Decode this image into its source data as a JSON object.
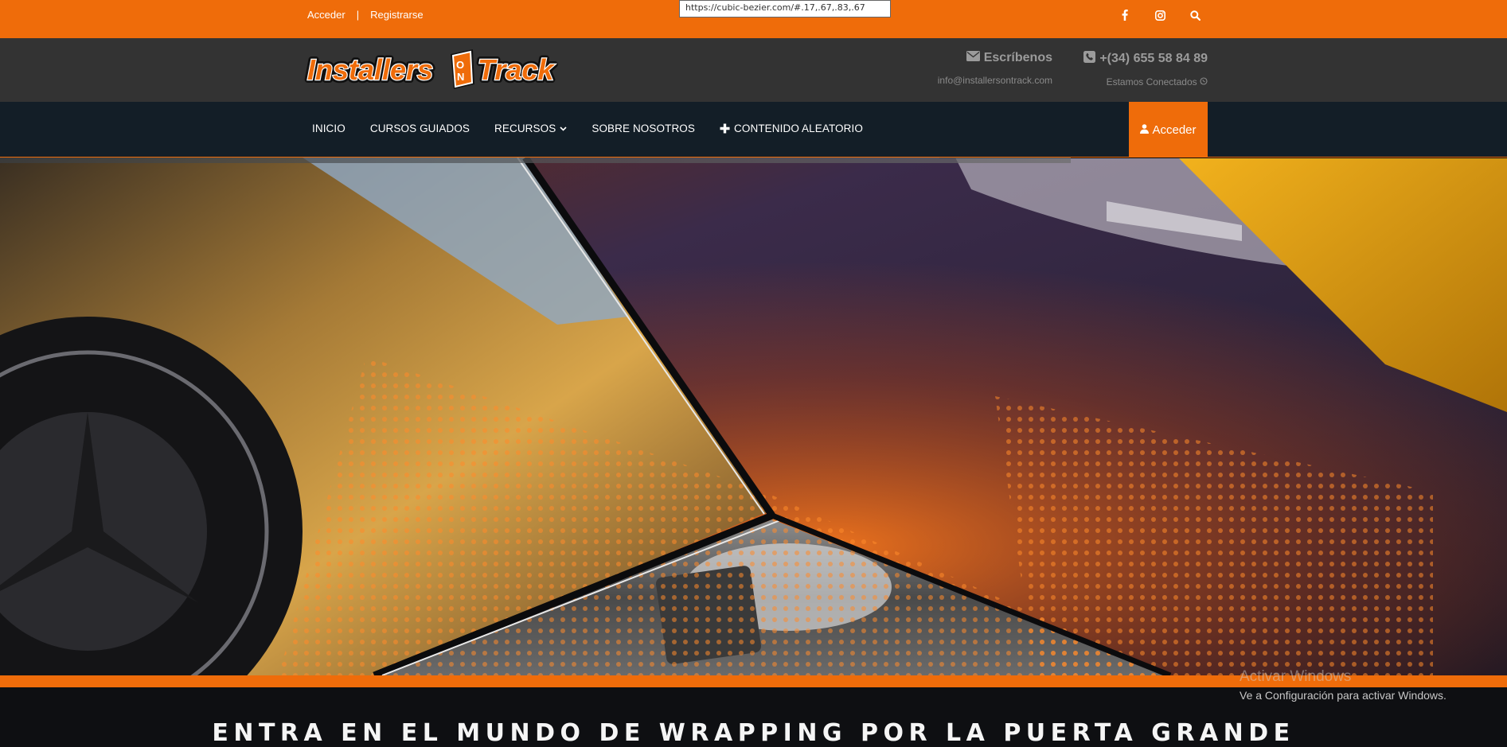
{
  "topbar": {
    "login_label": "Acceder",
    "separator": "|",
    "register_label": "Registrarse",
    "social_icons": [
      "facebook-icon",
      "instagram-icon",
      "search-icon"
    ]
  },
  "url_tooltip": "https://cubic-bezier.com/#.17,.67,.83,.67",
  "header": {
    "logo_text": "Installers ON Track",
    "email": {
      "title": "Escríbenos",
      "address": "info@installersontrack.com"
    },
    "phone": {
      "number": "+(34) 655 58 84 89",
      "status": "Estamos Conectados"
    }
  },
  "nav": {
    "items": [
      {
        "label": "INICIO"
      },
      {
        "label": "CURSOS GUIADOS"
      },
      {
        "label": "RECURSOS"
      },
      {
        "label": "SOBRE NOSOTROS"
      },
      {
        "label": "CONTENIDO ALEATORIO"
      }
    ],
    "login_button": "Acceder"
  },
  "hero": {
    "headline": "ENTRA EN EL MUNDO DE WRAPPING POR LA PUERTA GRANDE"
  },
  "watermark": {
    "title": "Activar Windows",
    "subtitle": "Ve a Configuración para activar Windows."
  },
  "colors": {
    "accent": "#ef6c0a",
    "header_bg": "#333333",
    "nav_bg": "#131e27"
  }
}
